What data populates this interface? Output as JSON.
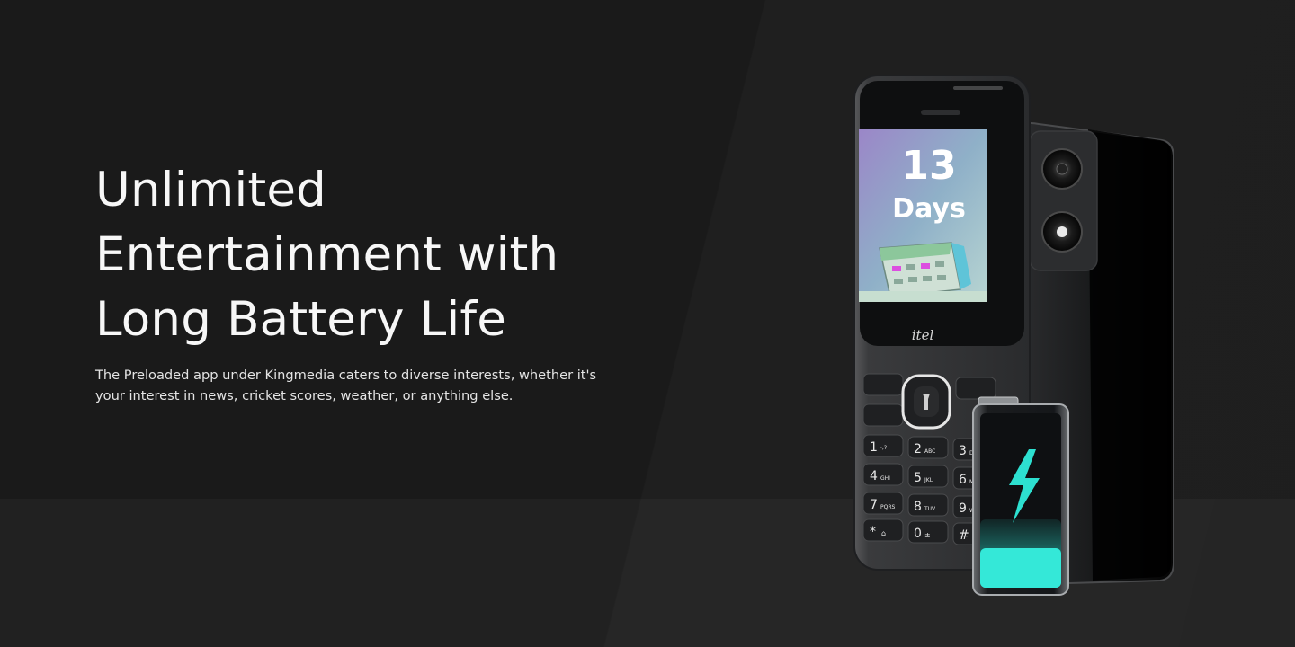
{
  "hero": {
    "title_lines": [
      "Unlimited",
      "Entertainment with",
      "Long Battery Life"
    ],
    "description": "The Preloaded app under Kingmedia caters to diverse interests, whether it's your interest in news, cricket scores, weather, or anything else."
  },
  "phone": {
    "brand_logo": "itel",
    "screen": {
      "number": "13",
      "label": "Days"
    },
    "keys": [
      {
        "digit": "1",
        "sub": "·,?"
      },
      {
        "digit": "2",
        "sub": "ABC"
      },
      {
        "digit": "3",
        "sub": "DEF"
      },
      {
        "digit": "4",
        "sub": "GHI"
      },
      {
        "digit": "5",
        "sub": "JKL"
      },
      {
        "digit": "6",
        "sub": "MNO"
      },
      {
        "digit": "7",
        "sub": "PQRS"
      },
      {
        "digit": "8",
        "sub": "TUV"
      },
      {
        "digit": "9",
        "sub": "WXYZ"
      },
      {
        "digit": "*",
        "sub": "⌂"
      },
      {
        "digit": "0",
        "sub": "±"
      },
      {
        "digit": "#",
        "sub": ""
      }
    ]
  },
  "colors": {
    "background": "#1a1a1a",
    "background_lower": "#212121",
    "battery_glow": "#2de0d0"
  },
  "icons": [
    "calendar-icon",
    "flashlight-icon",
    "lightning-bolt-icon",
    "battery-icon",
    "camera-lens-icon"
  ]
}
